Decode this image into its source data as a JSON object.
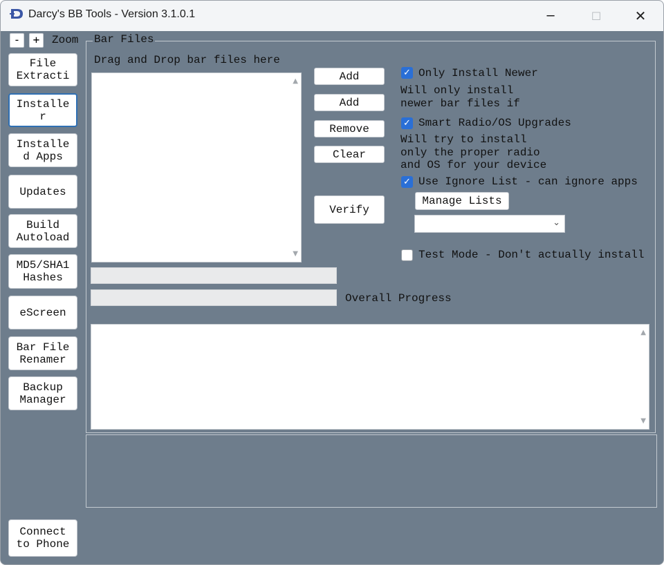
{
  "window": {
    "title": "Darcy's BB Tools - Version 3.1.0.1",
    "logo_icon": "darcy-logo-icon",
    "controls": {
      "minimize": "─",
      "maximize": "☐",
      "close": "✕"
    }
  },
  "zoom": {
    "minus": "-",
    "plus": "+",
    "label": "Zoom"
  },
  "sidebar": {
    "items": [
      {
        "label": "File\nExtracti",
        "active": false
      },
      {
        "label": "Installe\nr",
        "active": true
      },
      {
        "label": "Installe\nd Apps",
        "active": false
      },
      {
        "label": "Updates",
        "active": false
      },
      {
        "label": "Build\nAutoload",
        "active": false
      },
      {
        "label": "MD5/SHA1\nHashes",
        "active": false
      },
      {
        "label": "eScreen",
        "active": false
      },
      {
        "label": "Bar File\nRenamer",
        "active": false
      },
      {
        "label": "Backup\nManager",
        "active": false
      }
    ],
    "connect": "Connect\nto Phone"
  },
  "bar_files": {
    "legend": "Bar Files",
    "drop_hint": "Drag and Drop bar files here",
    "buttons": {
      "add1": "Add",
      "add2": "Add",
      "remove": "Remove",
      "clear": "Clear",
      "verify": "Verify"
    }
  },
  "options": {
    "only_install_newer": {
      "label": "Only Install Newer",
      "checked": true,
      "desc1": "Will only install",
      "desc2": "newer bar files if"
    },
    "smart_upgrades": {
      "label": "Smart Radio/OS Upgrades",
      "checked": true,
      "desc1": "Will try to install",
      "desc2": "only the proper radio",
      "desc3": "and OS for your device"
    },
    "ignore_list": {
      "label": "Use Ignore List - can ignore apps",
      "checked": true
    },
    "manage_lists": "Manage Lists",
    "list_select_value": "",
    "test_mode": {
      "label": "Test Mode - Don't actually install",
      "checked": false
    }
  },
  "progress": {
    "file_progress": 0,
    "overall_progress": 0,
    "overall_label": "Overall Progress"
  },
  "colors": {
    "background": "#6e7d8c",
    "accent": "#2a6fd6",
    "button": "#ffffff"
  }
}
